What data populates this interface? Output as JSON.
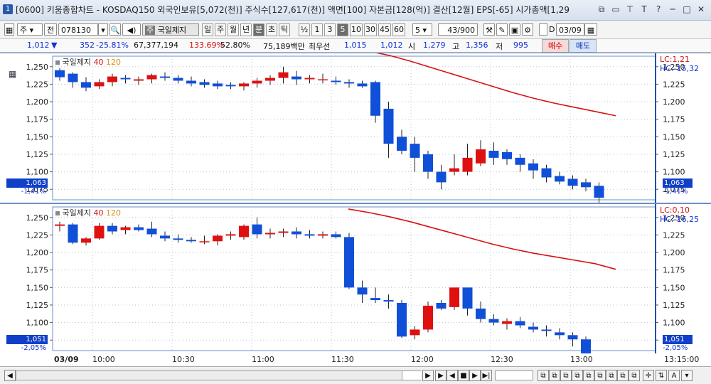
{
  "window": {
    "app_icon": "1",
    "title": "[0600] 키움종합차트 - KOSDAQ150 외국인보유[5,072(천)] 주식수[127,617(천)] 액면[100] 자본금[128(억)] 결산[12월] EPS[-65] 시가총액[1,29",
    "controls": [
      "⧉",
      "▭",
      "⊤",
      "T",
      "?",
      "─",
      "□",
      "✕"
    ]
  },
  "toolbar": {
    "period_select": "주",
    "prev_label": "전",
    "code_value": "078130",
    "stock_name": "국일제지",
    "periods": [
      "일",
      "주",
      "월",
      "년",
      "분",
      "초",
      "틱"
    ],
    "selected_period": "분",
    "intervals": [
      "½",
      "1",
      "3",
      "5",
      "10",
      "30",
      "45",
      "60"
    ],
    "selected_interval": "5",
    "interval_value": "5",
    "count_value": "43/900",
    "checkbox_label": "D",
    "date_value": "03/09"
  },
  "quote": {
    "price": "1,012",
    "arrow": "▼",
    "change": "352",
    "change_pct": "-25.81%",
    "volume": "67,377,194",
    "vol_ratio": "133.69%",
    "turnover": "52.80%",
    "amount": "75,189백만",
    "best_label": "최우선",
    "best_ask": "1,015",
    "best_bid": "1,012",
    "open_label": "시",
    "open": "1,279",
    "high_label": "고",
    "high": "1,356",
    "low_label": "저",
    "low": "995",
    "buy_label": "매수",
    "sell_label": "매도"
  },
  "panes": [
    {
      "legend_name": "국일제지",
      "ma1": "40",
      "ma2": "120",
      "lc": "LC:1,21",
      "hc": "HC:-15,32",
      "current_price": "1,063",
      "current_pct": "-1,41%",
      "y_ticks": [
        "1,250",
        "1,225",
        "1,200",
        "1,175",
        "1,150",
        "1,125",
        "1,100",
        "1,075"
      ]
    },
    {
      "legend_name": "국일제지",
      "ma1": "40",
      "ma2": "120",
      "lc": "LC:0,10",
      "hc": "HC:-16,25",
      "current_price": "1,051",
      "current_pct": "-2,05%",
      "y_ticks": [
        "1,250",
        "1,225",
        "1,200",
        "1,175",
        "1,150",
        "1,125",
        "1,100",
        "1,075"
      ]
    }
  ],
  "x_axis": {
    "date": "03/09",
    "ticks": [
      "10:00",
      "10:30",
      "11:00",
      "11:30",
      "12:00",
      "12:30",
      "13:00"
    ],
    "end_time": "13:15:00"
  },
  "colors": {
    "up": "#e01010",
    "down": "#1050d8",
    "ma": "#d81010",
    "grid": "#8899bb"
  },
  "chart_data": {
    "type": "candlestick",
    "y_range": [
      1060,
      1265
    ],
    "candles_pane1": [
      [
        1245,
        1248,
        1230,
        1235
      ],
      [
        1240,
        1242,
        1220,
        1228
      ],
      [
        1228,
        1235,
        1215,
        1220
      ],
      [
        1222,
        1232,
        1218,
        1228
      ],
      [
        1228,
        1240,
        1222,
        1236
      ],
      [
        1234,
        1238,
        1226,
        1232
      ],
      [
        1230,
        1236,
        1224,
        1232
      ],
      [
        1232,
        1240,
        1226,
        1238
      ],
      [
        1236,
        1242,
        1230,
        1234
      ],
      [
        1234,
        1238,
        1226,
        1230
      ],
      [
        1230,
        1236,
        1222,
        1226
      ],
      [
        1228,
        1232,
        1220,
        1224
      ],
      [
        1226,
        1230,
        1218,
        1222
      ],
      [
        1224,
        1228,
        1218,
        1222
      ],
      [
        1222,
        1228,
        1216,
        1226
      ],
      [
        1226,
        1234,
        1220,
        1230
      ],
      [
        1230,
        1238,
        1224,
        1234
      ],
      [
        1234,
        1250,
        1226,
        1242
      ],
      [
        1236,
        1244,
        1224,
        1232
      ],
      [
        1232,
        1238,
        1226,
        1234
      ],
      [
        1232,
        1240,
        1226,
        1232
      ],
      [
        1230,
        1236,
        1224,
        1228
      ],
      [
        1228,
        1232,
        1220,
        1226
      ],
      [
        1226,
        1230,
        1220,
        1222
      ],
      [
        1228,
        1230,
        1170,
        1180
      ],
      [
        1190,
        1200,
        1120,
        1140
      ],
      [
        1150,
        1160,
        1125,
        1130
      ],
      [
        1140,
        1150,
        1100,
        1120
      ],
      [
        1125,
        1130,
        1090,
        1100
      ],
      [
        1100,
        1110,
        1075,
        1085
      ],
      [
        1100,
        1125,
        1095,
        1105
      ],
      [
        1100,
        1140,
        1095,
        1120
      ],
      [
        1112,
        1145,
        1108,
        1132
      ],
      [
        1130,
        1142,
        1110,
        1120
      ],
      [
        1128,
        1132,
        1110,
        1118
      ],
      [
        1120,
        1125,
        1100,
        1110
      ],
      [
        1112,
        1118,
        1090,
        1102
      ],
      [
        1105,
        1110,
        1085,
        1092
      ],
      [
        1094,
        1100,
        1082,
        1086
      ],
      [
        1090,
        1095,
        1075,
        1080
      ],
      [
        1085,
        1090,
        1072,
        1078
      ],
      [
        1080,
        1085,
        1055,
        1063
      ]
    ],
    "candles_pane2": [
      [
        1238,
        1244,
        1230,
        1240
      ],
      [
        1240,
        1242,
        1212,
        1214
      ],
      [
        1214,
        1222,
        1210,
        1220
      ],
      [
        1220,
        1242,
        1218,
        1238
      ],
      [
        1238,
        1242,
        1226,
        1230
      ],
      [
        1232,
        1238,
        1226,
        1236
      ],
      [
        1236,
        1240,
        1230,
        1232
      ],
      [
        1234,
        1244,
        1222,
        1226
      ],
      [
        1224,
        1230,
        1216,
        1220
      ],
      [
        1220,
        1226,
        1214,
        1218
      ],
      [
        1218,
        1222,
        1214,
        1216
      ],
      [
        1216,
        1224,
        1212,
        1216
      ],
      [
        1216,
        1226,
        1210,
        1224
      ],
      [
        1224,
        1230,
        1218,
        1226
      ],
      [
        1222,
        1240,
        1218,
        1238
      ],
      [
        1240,
        1250,
        1220,
        1226
      ],
      [
        1226,
        1234,
        1220,
        1228
      ],
      [
        1228,
        1234,
        1222,
        1230
      ],
      [
        1230,
        1236,
        1220,
        1226
      ],
      [
        1226,
        1232,
        1220,
        1224
      ],
      [
        1224,
        1230,
        1220,
        1226
      ],
      [
        1226,
        1230,
        1220,
        1222
      ],
      [
        1222,
        1228,
        1148,
        1150
      ],
      [
        1150,
        1160,
        1128,
        1140
      ],
      [
        1135,
        1150,
        1128,
        1132
      ],
      [
        1132,
        1140,
        1120,
        1130
      ],
      [
        1128,
        1132,
        1078,
        1080
      ],
      [
        1082,
        1095,
        1076,
        1090
      ],
      [
        1090,
        1130,
        1086,
        1124
      ],
      [
        1128,
        1132,
        1118,
        1120
      ],
      [
        1122,
        1150,
        1118,
        1150
      ],
      [
        1150,
        1150,
        1110,
        1120
      ],
      [
        1120,
        1130,
        1100,
        1105
      ],
      [
        1105,
        1112,
        1096,
        1100
      ],
      [
        1098,
        1106,
        1090,
        1102
      ],
      [
        1102,
        1108,
        1092,
        1096
      ],
      [
        1094,
        1100,
        1086,
        1090
      ],
      [
        1090,
        1096,
        1080,
        1088
      ],
      [
        1086,
        1092,
        1076,
        1082
      ],
      [
        1082,
        1086,
        1066,
        1076
      ],
      [
        1076,
        1080,
        1050,
        1053
      ]
    ],
    "ma_pane1": [
      1277,
      1272,
      1266,
      1258,
      1249,
      1240,
      1231,
      1222,
      1213,
      1205,
      1198,
      1192,
      1186,
      1180
    ],
    "ma_pane2": [
      1262,
      1257,
      1251,
      1244,
      1236,
      1228,
      1220,
      1212,
      1205,
      1199,
      1194,
      1189,
      1184,
      1176
    ]
  }
}
